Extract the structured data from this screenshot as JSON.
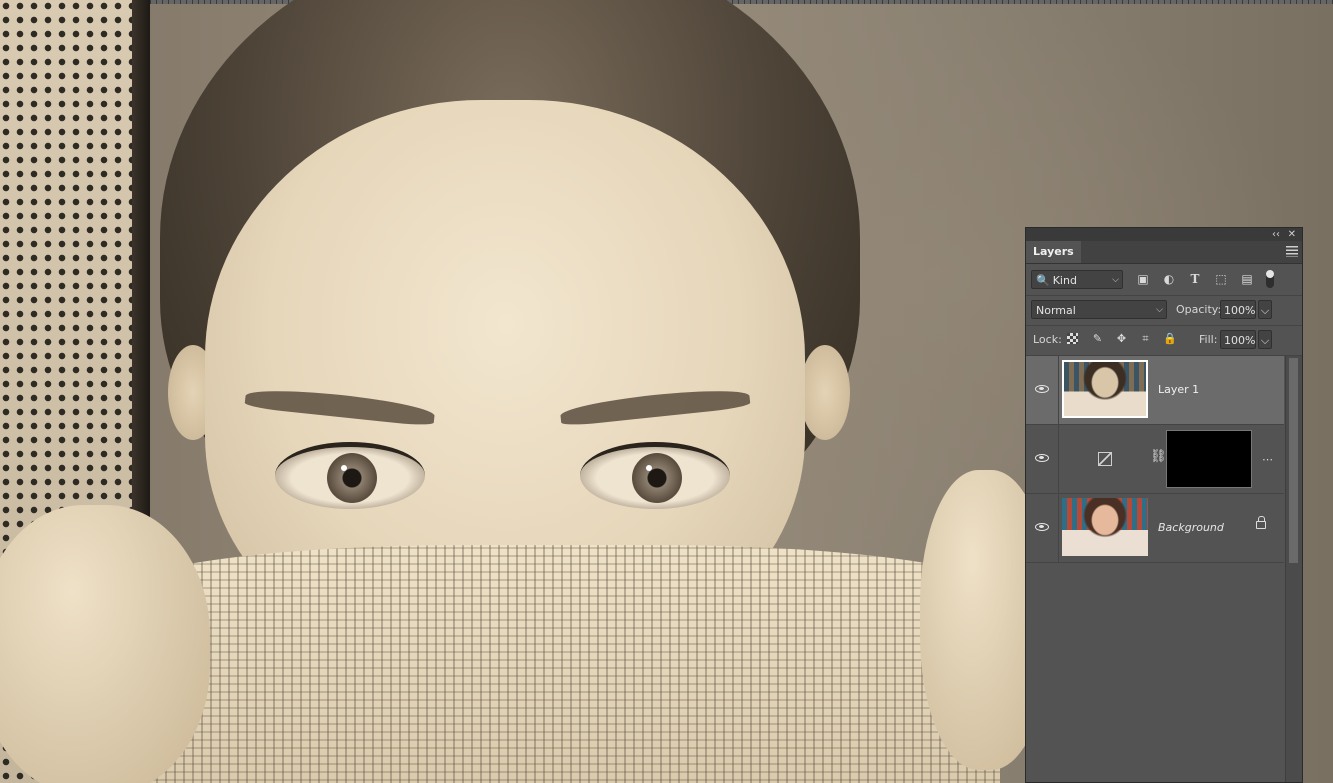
{
  "panel": {
    "title": "Layers",
    "collapse_glyph": "‹‹",
    "close_glyph": "✕",
    "filter": {
      "kind_label": "Kind",
      "search_glyph": "🔍",
      "chevron": "⌵"
    },
    "filter_icons": [
      "image-icon",
      "adjustment-icon",
      "type-icon",
      "shape-icon",
      "smart-object-icon"
    ],
    "filter_glyphs": {
      "pixel": "▣",
      "adjust": "◐",
      "type": "T",
      "shape": "⬚",
      "smart": "▤"
    },
    "blend_mode": "Normal",
    "opacity_label": "Opacity:",
    "opacity_value": "100%",
    "lock_label": "Lock:",
    "lock_glyphs": {
      "paint": "✎",
      "position": "✥",
      "artboard": "⌗",
      "all": "🔒"
    },
    "fill_label": "Fill:",
    "fill_value": "100%",
    "dropdown_glyph": "⌵"
  },
  "layers": [
    {
      "name": "Layer 1",
      "selected": true
    },
    {
      "name": "",
      "type": "adjustment",
      "chain_glyph": "⛓",
      "more_glyph": "⋯"
    },
    {
      "name": "Background",
      "locked": true
    }
  ],
  "colors": {
    "panel_bg": "#535353",
    "selected_row": "#6b6b6b",
    "canvas_tone": "#d9c9ab"
  }
}
